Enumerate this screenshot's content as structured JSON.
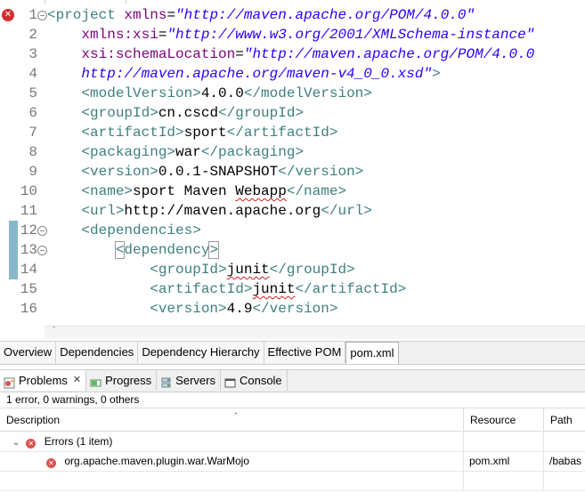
{
  "editor": {
    "lines": [
      {
        "num": "1",
        "marker": "error",
        "fold": "collapse",
        "tokens": [
          [
            "tag",
            "<project "
          ],
          [
            "attr",
            "xmlns"
          ],
          [
            "txt",
            "="
          ],
          [
            "val",
            "\"http://maven.apache.org/POM/4.0.0\""
          ]
        ]
      },
      {
        "num": "2",
        "tokens": [
          [
            "txt",
            "    "
          ],
          [
            "attr",
            "xmlns:xsi"
          ],
          [
            "txt",
            "="
          ],
          [
            "val",
            "\"http://www.w3.org/2001/XMLSchema-instance\""
          ]
        ]
      },
      {
        "num": "3",
        "tokens": [
          [
            "txt",
            "    "
          ],
          [
            "attr",
            "xsi:schemaLocation"
          ],
          [
            "txt",
            "="
          ],
          [
            "val",
            "\"http://maven.apache.org/POM/4.0.0"
          ]
        ]
      },
      {
        "num": "4",
        "tokens": [
          [
            "val",
            "    http://maven.apache.org/maven-v4_0_0.xsd\""
          ],
          [
            "tag",
            ">"
          ]
        ]
      },
      {
        "num": "5",
        "tokens": [
          [
            "txt",
            "    "
          ],
          [
            "tag",
            "<modelVersion>"
          ],
          [
            "txt",
            "4.0.0"
          ],
          [
            "tag",
            "</modelVersion>"
          ]
        ]
      },
      {
        "num": "6",
        "tokens": [
          [
            "txt",
            "    "
          ],
          [
            "tag",
            "<groupId>"
          ],
          [
            "txt",
            "cn.cscd"
          ],
          [
            "tag",
            "</groupId>"
          ]
        ]
      },
      {
        "num": "7",
        "tokens": [
          [
            "txt",
            "    "
          ],
          [
            "tag",
            "<artifactId>"
          ],
          [
            "txt",
            "sport"
          ],
          [
            "tag",
            "</artifactId>"
          ]
        ]
      },
      {
        "num": "8",
        "tokens": [
          [
            "txt",
            "    "
          ],
          [
            "tag",
            "<packaging>"
          ],
          [
            "txt",
            "war"
          ],
          [
            "tag",
            "</packaging>"
          ]
        ]
      },
      {
        "num": "9",
        "tokens": [
          [
            "txt",
            "    "
          ],
          [
            "tag",
            "<version>"
          ],
          [
            "txt",
            "0.0.1-SNAPSHOT"
          ],
          [
            "tag",
            "</version>"
          ]
        ]
      },
      {
        "num": "10",
        "tokens": [
          [
            "txt",
            "    "
          ],
          [
            "tag",
            "<name>"
          ],
          [
            "txt",
            "sport Maven "
          ],
          [
            "sq",
            "Webapp"
          ],
          [
            "tag",
            "</name>"
          ]
        ]
      },
      {
        "num": "11",
        "tokens": [
          [
            "txt",
            "    "
          ],
          [
            "tag",
            "<url>"
          ],
          [
            "txt",
            "http://maven.apache.org"
          ],
          [
            "tag",
            "</url>"
          ]
        ]
      },
      {
        "num": "12",
        "fold": "collapse",
        "change": true,
        "tokens": [
          [
            "txt",
            "    "
          ],
          [
            "tag",
            "<dependencies>"
          ]
        ]
      },
      {
        "num": "13",
        "fold": "collapse",
        "change": true,
        "current": true,
        "tokens": [
          [
            "txt",
            "        "
          ],
          [
            "box",
            "<"
          ],
          [
            "tag",
            "dependency"
          ],
          [
            "box",
            ">"
          ],
          [
            "caret",
            ""
          ]
        ]
      },
      {
        "num": "14",
        "change": true,
        "tokens": [
          [
            "txt",
            "            "
          ],
          [
            "tag",
            "<groupId>"
          ],
          [
            "sq",
            "junit"
          ],
          [
            "tag",
            "</groupId>"
          ]
        ]
      },
      {
        "num": "15",
        "tokens": [
          [
            "txt",
            "            "
          ],
          [
            "tag",
            "<artifactId>"
          ],
          [
            "sq",
            "junit"
          ],
          [
            "tag",
            "</artifactId>"
          ]
        ]
      },
      {
        "num": "16",
        "tokens": [
          [
            "txt",
            "            "
          ],
          [
            "tag",
            "<version>"
          ],
          [
            "txt",
            "4.9"
          ],
          [
            "tag",
            "</version>"
          ]
        ]
      }
    ]
  },
  "editor_tabs": [
    {
      "label": "Overview",
      "active": false
    },
    {
      "label": "Dependencies",
      "active": false
    },
    {
      "label": "Dependency Hierarchy",
      "active": false
    },
    {
      "label": "Effective POM",
      "active": false
    },
    {
      "label": "pom.xml",
      "active": true
    }
  ],
  "views": {
    "tabs": [
      {
        "label": "Problems",
        "icon": "problems-icon",
        "active": true,
        "closable": true
      },
      {
        "label": "Progress",
        "icon": "progress-icon",
        "active": false
      },
      {
        "label": "Servers",
        "icon": "servers-icon",
        "active": false
      },
      {
        "label": "Console",
        "icon": "console-icon",
        "active": false
      }
    ]
  },
  "problems": {
    "summary": "1 error, 0 warnings, 0 others",
    "columns": {
      "description": "Description",
      "resource": "Resource",
      "path": "Path"
    },
    "group_label": "Errors (1 item)",
    "rows": [
      {
        "description": "org.apache.maven.plugin.war.WarMojo",
        "resource": "pom.xml",
        "path": "/babas"
      }
    ]
  },
  "colors": {
    "tag": "#3f7f7f",
    "attribute": "#7f007f",
    "value": "#2a00ff",
    "error": "#d32f2f"
  }
}
